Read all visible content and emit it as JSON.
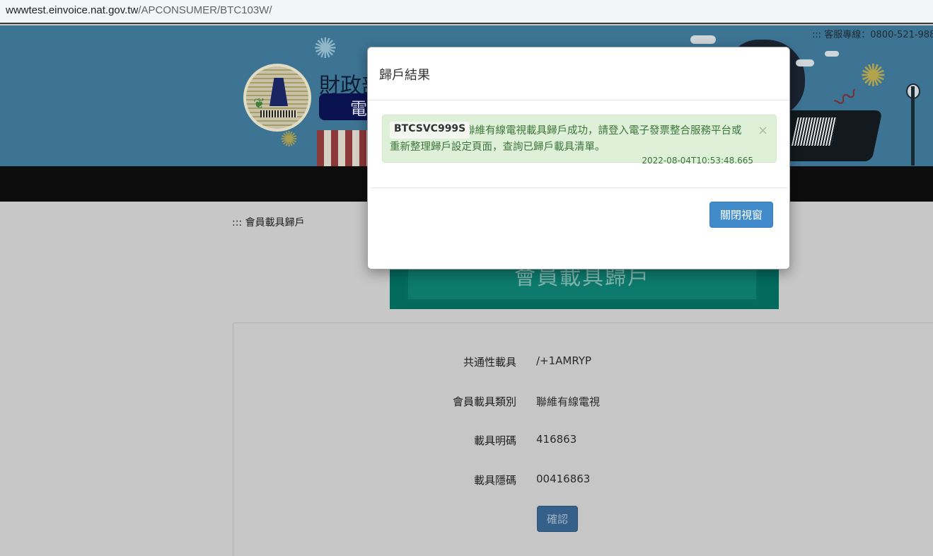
{
  "browser": {
    "url_host": "wwwtest.einvoice.nat.gov.tw",
    "url_path": "/APCONSUMER/BTC103W/"
  },
  "header": {
    "hotline": "::: 客服專線：0800-521-988",
    "site_title": "財政部",
    "site_subtitle": "電"
  },
  "breadcrumb": "::: 會員載具歸戶",
  "page_title": "會員載具歸戶",
  "form": {
    "rows": [
      {
        "label": "共通性載具",
        "value": "/+1AMRYP"
      },
      {
        "label": "會員載具類別",
        "value": "聯維有線電視"
      },
      {
        "label": "載具明碼",
        "value": "416863"
      },
      {
        "label": "載具隱碼",
        "value": "00416863"
      }
    ],
    "confirm_label": "確認"
  },
  "modal": {
    "title": "歸戶結果",
    "alert": {
      "code": "BTCSVC999S",
      "message": "聯維有線電視載具歸戶成功，請登入電子發票整合服務平台或重新整理歸戶設定頁面，查詢已歸戶載具清單。",
      "timestamp": "2022-08-04T10:53:48.665",
      "close_symbol": "×"
    },
    "close_button_label": "關閉視窗"
  },
  "colors": {
    "primary_button": "#428bca",
    "alert_background": "#dff0d8",
    "alert_text": "#3c763d",
    "title_ribbon": "#0d7a6d"
  }
}
